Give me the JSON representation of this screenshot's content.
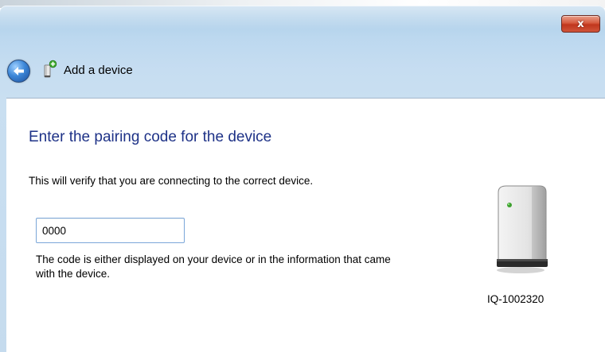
{
  "window": {
    "close_label": "x"
  },
  "nav": {
    "title": "Add a device"
  },
  "main": {
    "heading": "Enter the pairing code for the device",
    "subtext": "This will verify that you are connecting to the correct device.",
    "code_input_value": "0000",
    "help_text": "The code is either displayed on your device or in the information that came with the device."
  },
  "device": {
    "name": "IQ-1002320"
  },
  "icons": {
    "back": "back-arrow-icon",
    "add_device": "add-device-icon",
    "device_image": "device-tower-icon",
    "close": "close-icon"
  },
  "colors": {
    "heading": "#1e3287",
    "close_button": "#c0361d",
    "title_bar": "#bcd8ef"
  }
}
